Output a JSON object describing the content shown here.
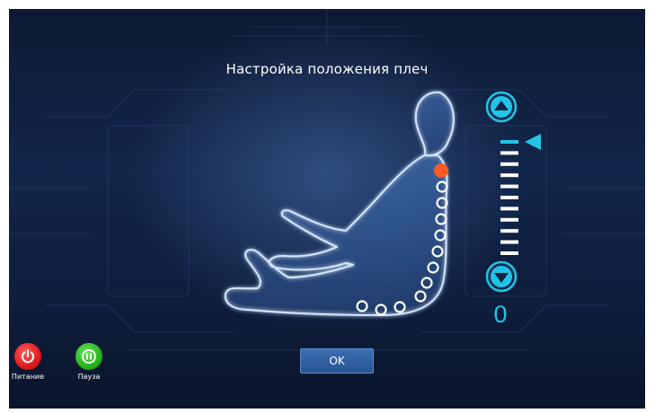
{
  "screen": {
    "title": "Настройка положения плеч"
  },
  "level": {
    "value": "0",
    "scale_total": 11,
    "current_index": 0
  },
  "actions": {
    "ok_label": "OK"
  },
  "controls": {
    "power_label": "Питание",
    "pause_label": "Пауза"
  },
  "spine_points": {
    "total": 12,
    "active_index": 0
  },
  "colors": {
    "accent": "#22c4e6",
    "active_point": "#ff5a1f",
    "power": "#e01b1b",
    "pause": "#25b41c",
    "ok_button": "#2a5592"
  },
  "icons": {
    "up": "triangle-up-icon",
    "down": "triangle-down-icon",
    "marker": "triangle-left-icon",
    "power": "power-icon",
    "pause": "pause-icon"
  }
}
